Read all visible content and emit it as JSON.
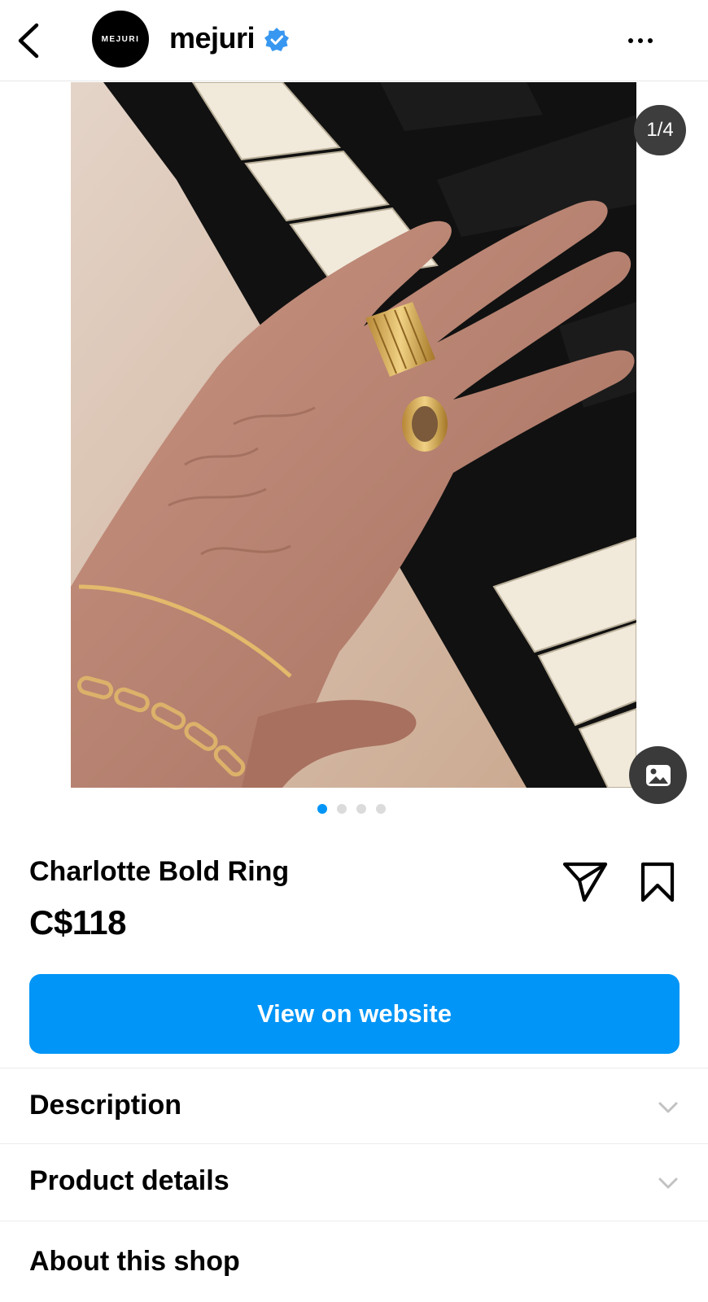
{
  "header": {
    "back_icon": "chevron-left-icon",
    "avatar_text": "MEJURI",
    "shop_name": "mejuri",
    "verified_icon": "verified-badge-icon",
    "more_icon": "more-horizontal-icon"
  },
  "media": {
    "counter": "1/4",
    "gallery_icon": "image-gallery-icon",
    "image_description_icon": "product-photo",
    "dots_total": 4,
    "dots_active": 1
  },
  "product": {
    "title": "Charlotte Bold Ring",
    "price": "C$118",
    "share_icon": "send-icon",
    "save_icon": "bookmark-icon"
  },
  "cta": {
    "label": "View on website"
  },
  "sections": [
    {
      "label": "Description",
      "icon": "chevron-down-icon"
    },
    {
      "label": "Product details",
      "icon": "chevron-down-icon"
    },
    {
      "label": "About this shop"
    }
  ],
  "colors": {
    "accent": "#0095f6",
    "verified": "#3897f0",
    "counter_bg": "#3d3d3d",
    "dot_inactive": "#dbdbdb"
  }
}
